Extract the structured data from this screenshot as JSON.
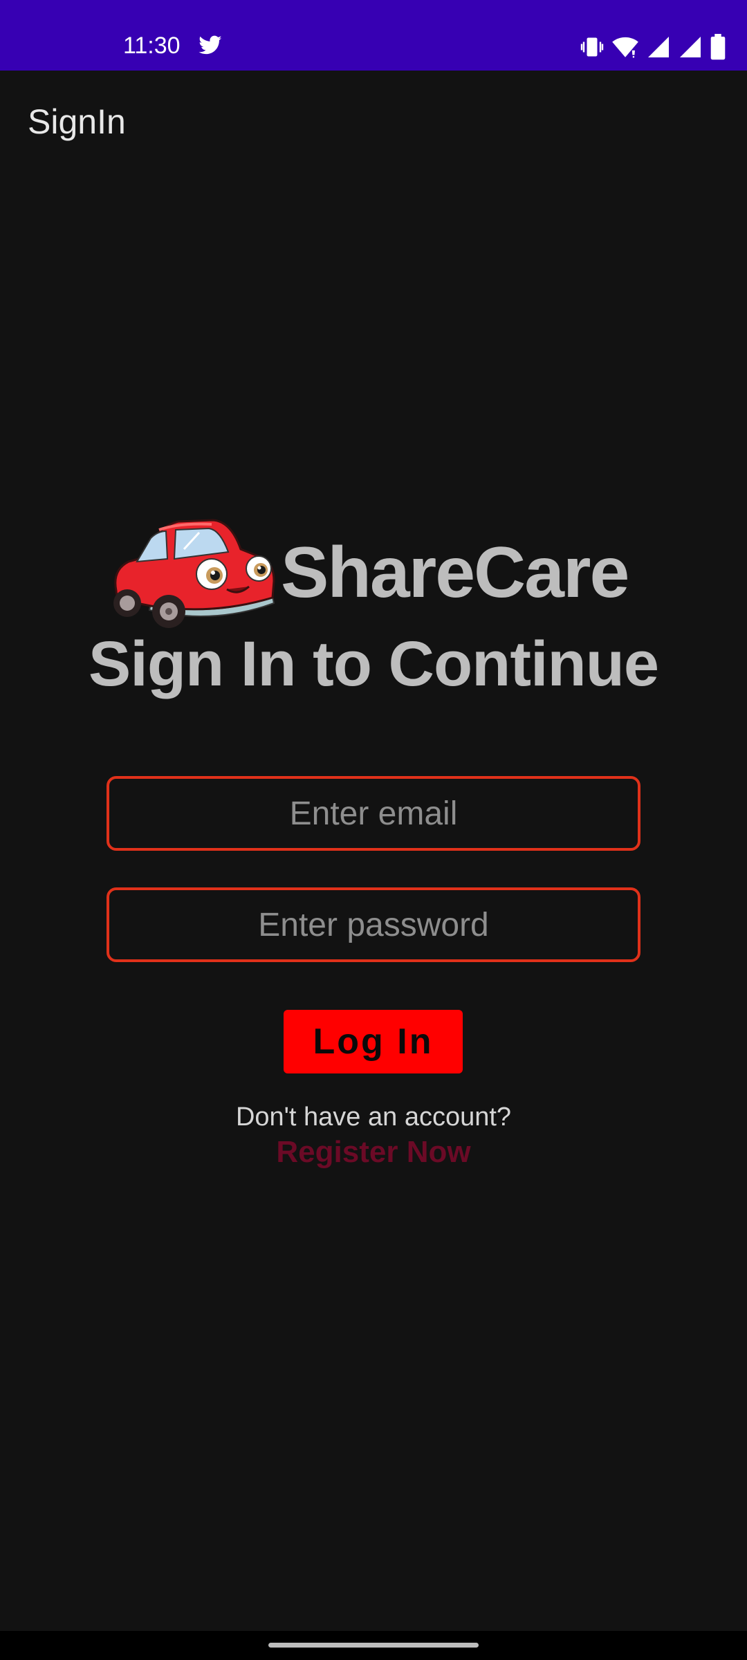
{
  "status_bar": {
    "time": "11:30",
    "notification_icon": "twitter-icon",
    "icons": [
      "vibrate-icon",
      "wifi-icon",
      "cell-signal-icon",
      "cell-signal-icon",
      "battery-icon"
    ],
    "background_color": "#3700b3"
  },
  "app_bar": {
    "title": "SignIn"
  },
  "brand": {
    "logo_icon": "car-mascot-icon",
    "name": "ShareCare"
  },
  "headline": "Sign In to Continue",
  "form": {
    "email": {
      "value": "",
      "placeholder": "Enter email"
    },
    "password": {
      "value": "",
      "placeholder": "Enter password"
    },
    "login_label": "Log In"
  },
  "register": {
    "prompt": "Don't have an account?",
    "link_label": "Register Now"
  },
  "colors": {
    "background": "#121212",
    "field_border": "#e0311a",
    "button": "#ff0000",
    "register_link": "#6b0a26",
    "text_muted": "#bdbdbd"
  }
}
